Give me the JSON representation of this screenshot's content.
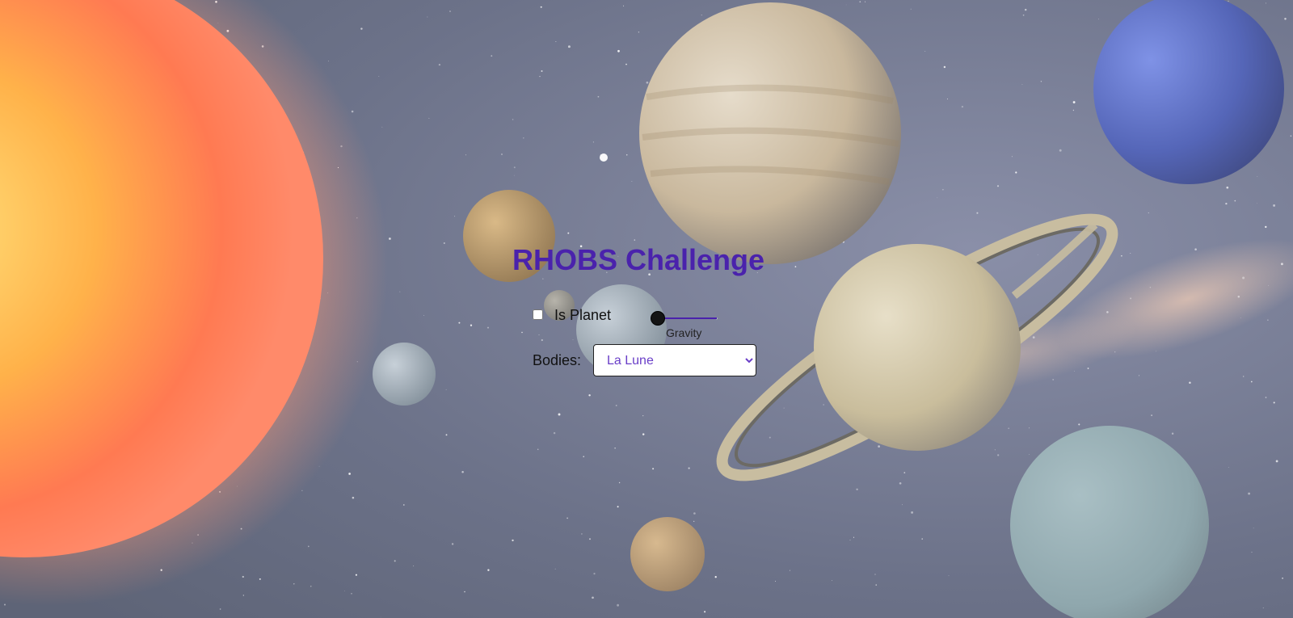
{
  "page": {
    "title": "RHOBS Challenge"
  },
  "form": {
    "is_planet": {
      "label": "Is Planet",
      "checked": false
    },
    "gravity": {
      "label": "Gravity",
      "min": 0,
      "max": 100,
      "value": 0
    },
    "bodies": {
      "label": "Bodies:",
      "selected": "La Lune",
      "options": [
        "La Lune"
      ]
    }
  },
  "colors": {
    "title": "#4a22ac",
    "select_text": "#6a3fc8",
    "slider_track": "#4a22ac",
    "slider_thumb": "#141414"
  },
  "icons": {
    "select_arrow": "chevron-down-icon"
  }
}
